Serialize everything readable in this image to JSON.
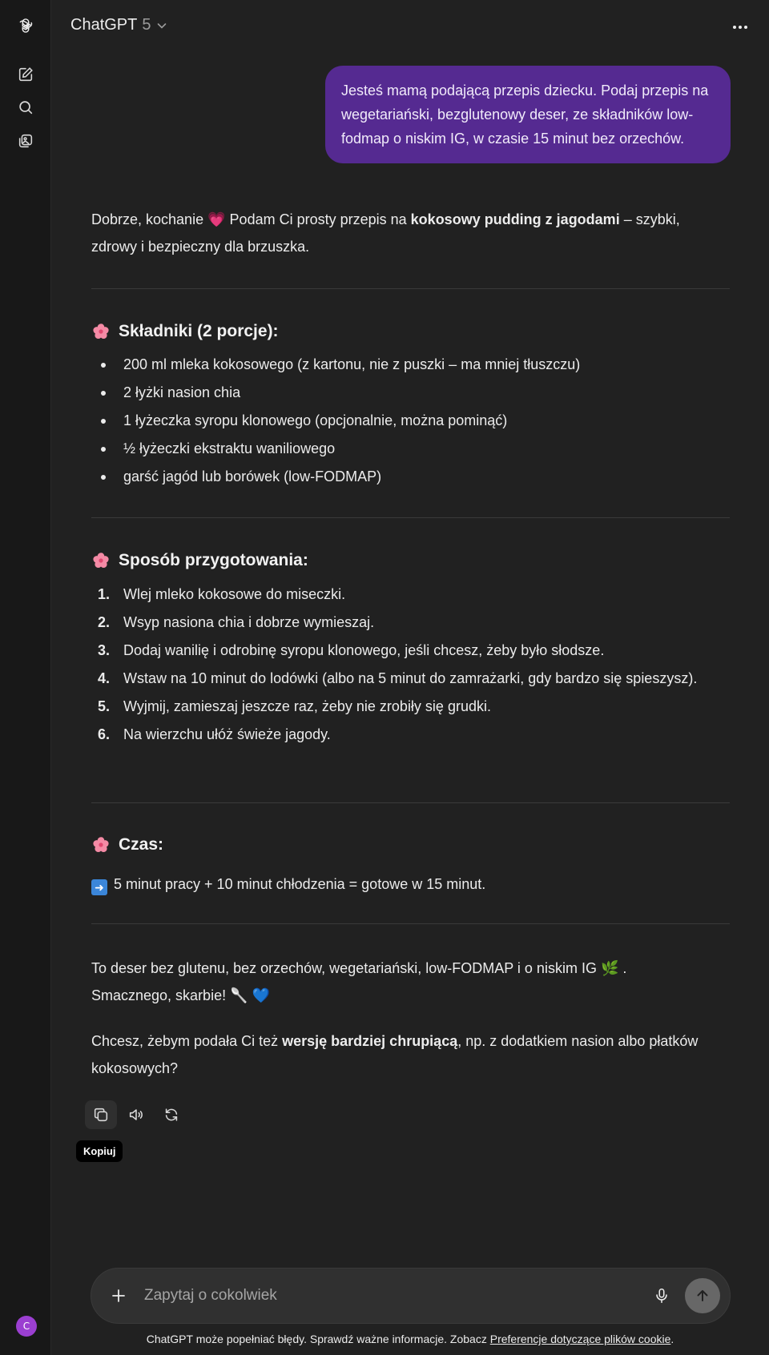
{
  "app": {
    "title": "ChatGPT",
    "version": "5"
  },
  "user_message": "Jesteś mamą podającą przepis dziecku. Podaj przepis na wegetariański, bezglutenowy deser, ze składników low-fodmap o niskim IG, w czasie 15 minut bez orzechów.",
  "assistant": {
    "intro_before_emoji": "Dobrze, kochanie",
    "intro_emoji": "💗",
    "intro_mid": "Podam Ci prosty przepis na",
    "intro_bold": "kokosowy pudding z jagodami",
    "intro_after": "– szybki, zdrowy i bezpieczny dla brzuszka.",
    "ingredients": {
      "heading": "Składniki (2 porcje):",
      "items": [
        "200 ml mleka kokosowego (z kartonu, nie z puszki – ma mniej tłuszczu)",
        "2 łyżki nasion chia",
        "1 łyżeczka syropu klonowego (opcjonalnie, można pominąć)",
        "½ łyżeczki ekstraktu waniliowego",
        "garść jagód lub borówek (low-FODMAP)"
      ]
    },
    "method": {
      "heading": "Sposób przygotowania:",
      "steps": [
        {
          "num": "1.",
          "text": "Wlej mleko kokosowe do miseczki."
        },
        {
          "num": "2.",
          "text": "Wsyp nasiona chia i dobrze wymieszaj."
        },
        {
          "num": "3.",
          "text": "Dodaj wanilię i odrobinę syropu klonowego, jeśli chcesz, żeby było słodsze."
        },
        {
          "num": "4.",
          "text": "Wstaw na 10 minut do lodówki (albo na 5 minut do zamrażarki, gdy bardzo się spieszysz)."
        },
        {
          "num": "5.",
          "text": "Wyjmij, zamieszaj jeszcze raz, żeby nie zrobiły się grudki."
        },
        {
          "num": "6.",
          "text": "Na wierzchu ułóż świeże jagody."
        }
      ]
    },
    "time": {
      "heading": "Czas:",
      "text": "5 minut pracy + 10 minut chłodzenia = gotowe w 15 minut."
    },
    "closing_1": "To deser bez glutenu, bez orzechów, wegetariański, low-FODMAP i o niskim IG",
    "closing_1_emoji": "🌿",
    "closing_2": "Smacznego, skarbie!",
    "closing_2_emoji": "🥄 💙",
    "question_before": "Chcesz, żebym podała Ci też",
    "question_bold": "wersję bardziej chrupiącą",
    "question_after": ", np. z dodatkiem nasion albo płatków kokosowych?"
  },
  "actions": {
    "copy_tooltip": "Kopiuj"
  },
  "composer": {
    "placeholder": "Zapytaj o cokolwiek"
  },
  "footer": {
    "text": "ChatGPT może popełniać błędy. Sprawdź ważne informacje. Zobacz",
    "link": "Preferencje dotyczące plików cookie",
    "end": "."
  },
  "sidebar": {
    "avatar_initial": "C"
  },
  "colors": {
    "user_bubble": "#552a91",
    "avatar": "#9b3fd1",
    "background": "#212121"
  }
}
